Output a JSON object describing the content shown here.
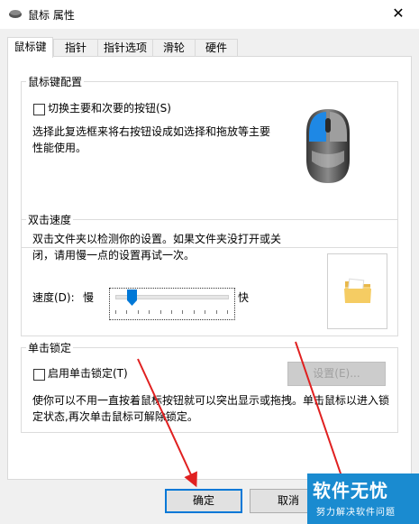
{
  "window": {
    "title": "鼠标 属性",
    "close_glyph": "✕"
  },
  "tabs": [
    {
      "label": "鼠标键",
      "active": true
    },
    {
      "label": "指针"
    },
    {
      "label": "指针选项"
    },
    {
      "label": "滑轮"
    },
    {
      "label": "硬件"
    }
  ],
  "button_config": {
    "title": "鼠标键配置",
    "checkbox_label": "切换主要和次要的按钮(S)",
    "checked": false,
    "description": "选择此复选框来将右按钮设成如选择和拖放等主要性能使用。"
  },
  "double_click": {
    "title": "双击速度",
    "description": "双击文件夹以检测你的设置。如果文件夹没打开或关闭，请用慢一点的设置再试一次。",
    "speed_label": "速度(D):",
    "slow": "慢",
    "fast": "快",
    "speed_value": 0.15
  },
  "click_lock": {
    "title": "单击锁定",
    "checkbox_label": "启用单击锁定(T)",
    "checked": false,
    "settings_button": "设置(E)...",
    "description": "使你可以不用一直按着鼠标按钮就可以突出显示或拖拽。单击鼠标以进入锁定状态,再次单击鼠标可解除锁定。"
  },
  "footer": {
    "ok": "确定",
    "cancel": "取消"
  },
  "watermark": {
    "line1": "软件无忧",
    "line2": "努力解决软件问题"
  },
  "colors": {
    "accent": "#0078d7",
    "arrow": "#e02020",
    "watermark": "#1a8bd0"
  }
}
